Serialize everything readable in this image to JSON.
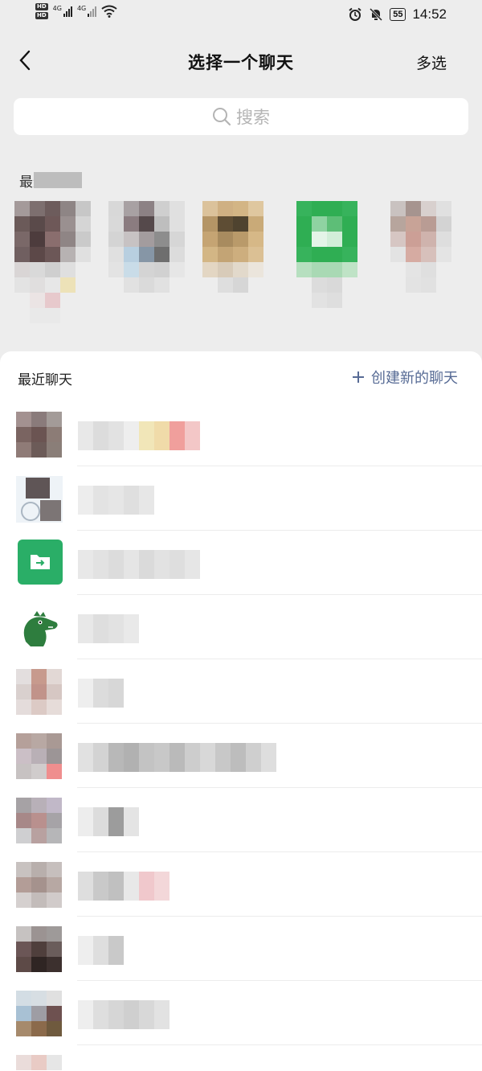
{
  "status_bar": {
    "hd1": "HD",
    "hd2": "HD",
    "net1": "4G",
    "net2": "4G",
    "battery": "55",
    "time": "14:52"
  },
  "nav": {
    "title": "选择一个聊天",
    "multi_select": "多选"
  },
  "search": {
    "placeholder": "搜索"
  },
  "recent_section": {
    "label": "最近转发"
  },
  "chat_list": {
    "header": "最近聊天",
    "create_label": "创建新的聊天"
  },
  "colors": {
    "background": "#ededed",
    "link": "#576b95",
    "folder_green": "#2aae67"
  }
}
